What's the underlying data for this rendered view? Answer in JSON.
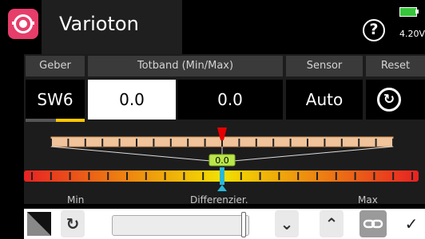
{
  "header": {
    "title": "Varioton",
    "app_icon": "speaker-icon",
    "help_icon": "question-mark-icon",
    "help_glyph": "?",
    "battery_icon": "battery-icon",
    "battery_text": "4.20V"
  },
  "table": {
    "columns": [
      "Geber",
      "Totband (Min/Max)",
      "Sensor",
      "Reset"
    ],
    "row": {
      "geber": "SW6",
      "totband_min": "0.0",
      "totband_max": "0.0",
      "sensor": "Auto",
      "reset_icon": "reset-icon",
      "reset_glyph": "↻"
    }
  },
  "bar": {
    "value_label": "0.0",
    "scale_labels": [
      "Min",
      "Differenzier.",
      "Max"
    ],
    "colors": {
      "upper_bar": "#f0c39a",
      "lower_start": "#e82222",
      "lower_mid": "#f3e000",
      "marker_red": "#e60000",
      "marker_cyan": "#2ab8d6",
      "value_badge": "#b9e64a"
    }
  },
  "toolbar": {
    "buttons": [
      "corner-icon",
      "reset-icon",
      "chevron-down-icon",
      "chevron-up-icon",
      "link-icon",
      "check-icon"
    ],
    "reset_glyph": "↻",
    "down_glyph": "⌄",
    "up_glyph": "⌃",
    "check_glyph": "✓"
  }
}
